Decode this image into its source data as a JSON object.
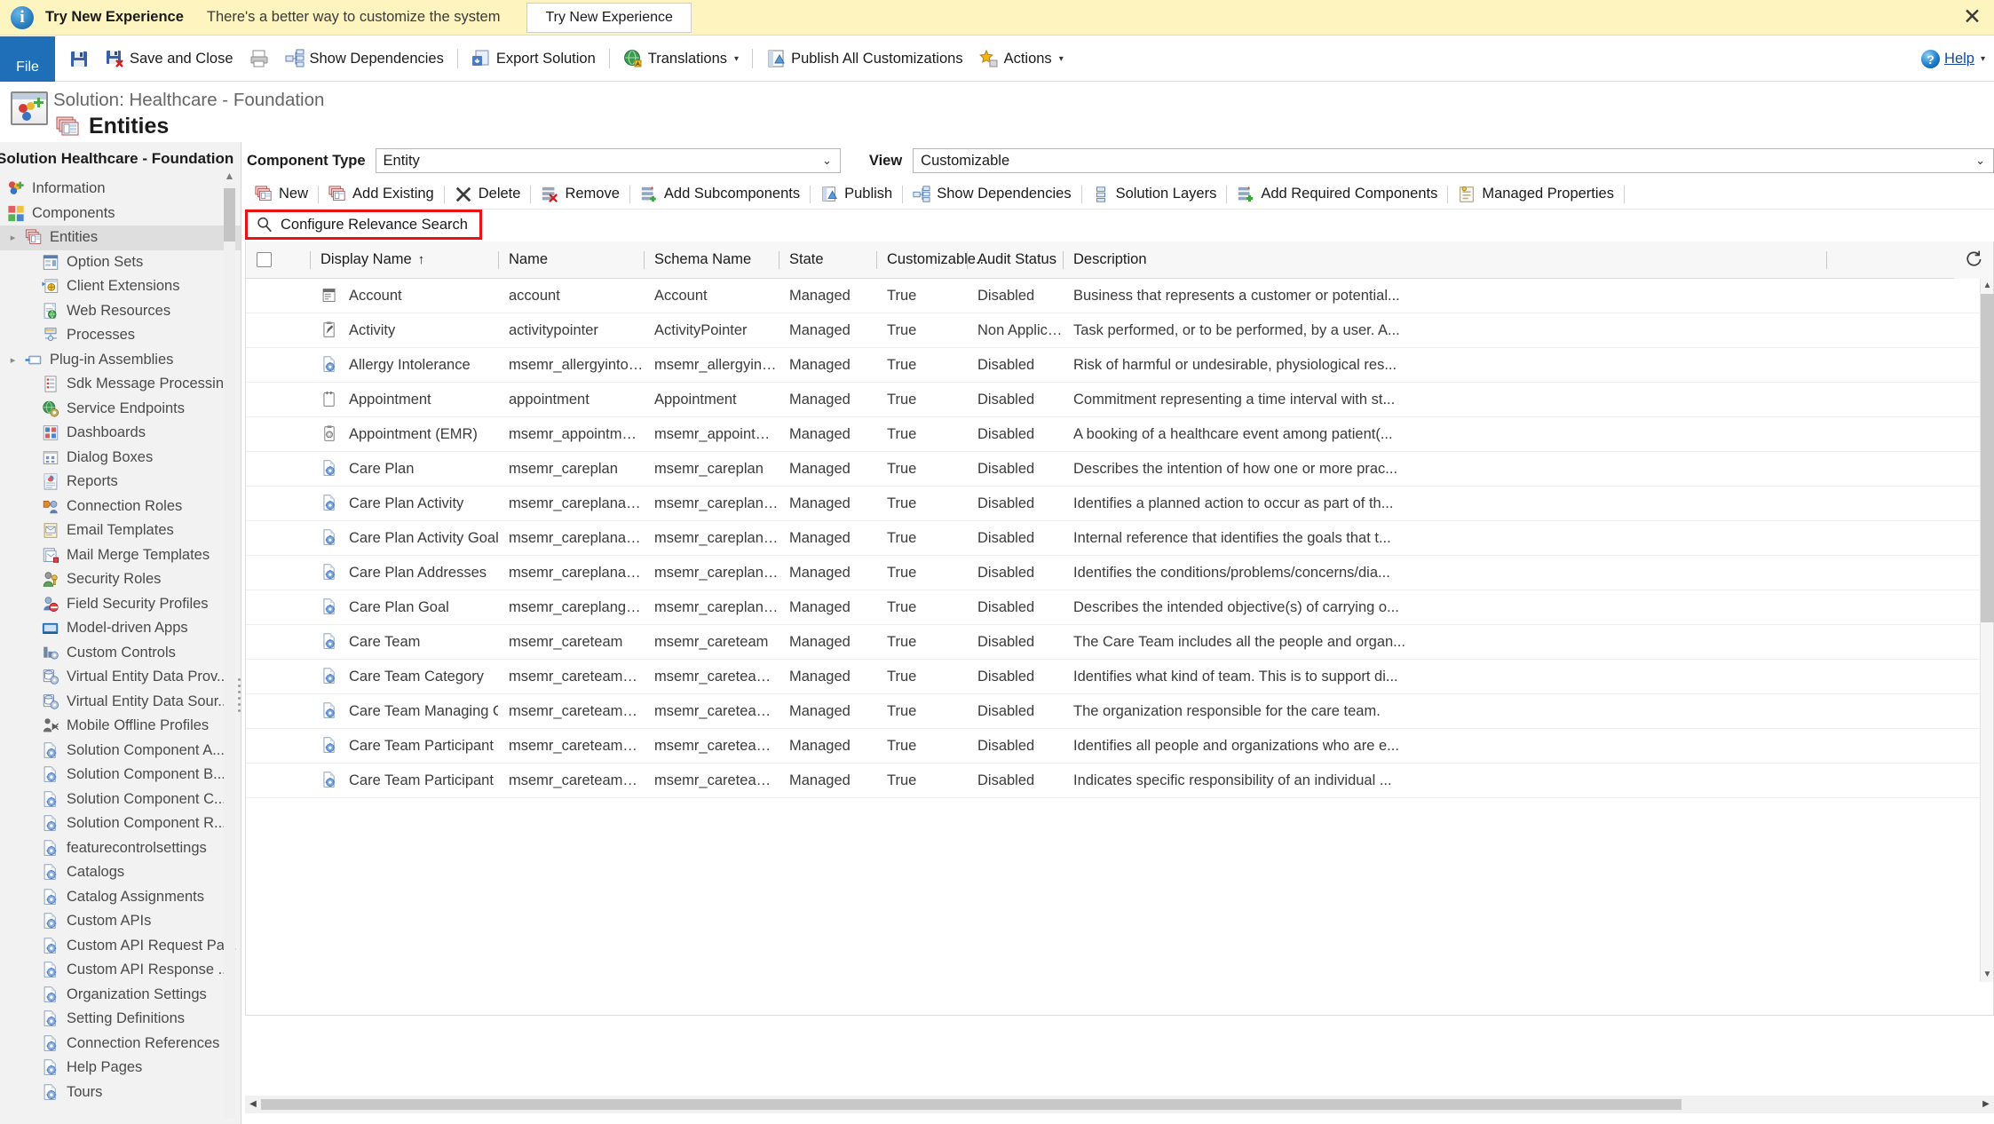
{
  "notification": {
    "title": "Try New Experience",
    "message": "There's a better way to customize the system",
    "button": "Try New Experience",
    "close": "✕",
    "bg_color": "#fdf4bf"
  },
  "command_bar": {
    "file_tab": "File",
    "items": [
      {
        "name": "save",
        "label": "",
        "icon": "save-icon"
      },
      {
        "name": "save-and-close",
        "label": "Save and Close",
        "icon": "save-close-icon"
      },
      {
        "name": "print",
        "label": "",
        "icon": "print-icon"
      },
      {
        "name": "show-dependencies",
        "label": "Show Dependencies",
        "icon": "dependencies-icon"
      },
      {
        "name": "export-solution",
        "label": "Export Solution",
        "icon": "export-icon"
      },
      {
        "name": "translations",
        "label": "Translations",
        "icon": "globe-icon",
        "caret": "▾"
      },
      {
        "name": "publish-all-customizations",
        "label": "Publish All Customizations",
        "icon": "publish-icon"
      },
      {
        "name": "actions",
        "label": "Actions",
        "icon": "star-icon",
        "caret": "▾"
      }
    ],
    "help": "Help",
    "help_caret": "▾"
  },
  "solution_header": {
    "title": "Solution: Healthcare - Foundation",
    "section": "Entities"
  },
  "sidebar": {
    "title": "Solution Healthcare - Foundation",
    "items": [
      {
        "label": "Information",
        "level": 1,
        "icon": "information-icon",
        "arrow": "",
        "selected": false
      },
      {
        "label": "Components",
        "level": 1,
        "icon": "components-icon",
        "arrow": "",
        "selected": false
      },
      {
        "label": "Entities",
        "level": 2,
        "icon": "entities-icon",
        "arrow": "▸",
        "selected": true
      },
      {
        "label": "Option Sets",
        "level": 2,
        "icon": "option-sets-icon",
        "arrow": "",
        "selected": false
      },
      {
        "label": "Client Extensions",
        "level": 2,
        "icon": "client-extensions-icon",
        "arrow": "",
        "selected": false
      },
      {
        "label": "Web Resources",
        "level": 2,
        "icon": "web-resources-icon",
        "arrow": "",
        "selected": false
      },
      {
        "label": "Processes",
        "level": 2,
        "icon": "processes-icon",
        "arrow": "",
        "selected": false
      },
      {
        "label": "Plug-in Assemblies",
        "level": 2,
        "icon": "plugin-assemblies-icon",
        "arrow": "▸",
        "selected": false
      },
      {
        "label": "Sdk Message Processin...",
        "level": 2,
        "icon": "sdk-message-icon",
        "arrow": "",
        "selected": false
      },
      {
        "label": "Service Endpoints",
        "level": 2,
        "icon": "service-endpoints-icon",
        "arrow": "",
        "selected": false
      },
      {
        "label": "Dashboards",
        "level": 2,
        "icon": "dashboards-icon",
        "arrow": "",
        "selected": false
      },
      {
        "label": "Dialog Boxes",
        "level": 2,
        "icon": "dialog-boxes-icon",
        "arrow": "",
        "selected": false
      },
      {
        "label": "Reports",
        "level": 2,
        "icon": "reports-icon",
        "arrow": "",
        "selected": false
      },
      {
        "label": "Connection Roles",
        "level": 2,
        "icon": "connection-roles-icon",
        "arrow": "",
        "selected": false
      },
      {
        "label": "Email Templates",
        "level": 2,
        "icon": "email-templates-icon",
        "arrow": "",
        "selected": false
      },
      {
        "label": "Mail Merge Templates",
        "level": 2,
        "icon": "mail-merge-icon",
        "arrow": "",
        "selected": false
      },
      {
        "label": "Security Roles",
        "level": 2,
        "icon": "security-roles-icon",
        "arrow": "",
        "selected": false
      },
      {
        "label": "Field Security Profiles",
        "level": 2,
        "icon": "field-security-icon",
        "arrow": "",
        "selected": false
      },
      {
        "label": "Model-driven Apps",
        "level": 2,
        "icon": "model-driven-apps-icon",
        "arrow": "",
        "selected": false
      },
      {
        "label": "Custom Controls",
        "level": 2,
        "icon": "custom-controls-icon",
        "arrow": "",
        "selected": false
      },
      {
        "label": "Virtual Entity Data Prov...",
        "level": 2,
        "icon": "virtual-entity-provider-icon",
        "arrow": "",
        "selected": false
      },
      {
        "label": "Virtual Entity Data Sour...",
        "level": 2,
        "icon": "virtual-entity-source-icon",
        "arrow": "",
        "selected": false
      },
      {
        "label": "Mobile Offline Profiles",
        "level": 2,
        "icon": "mobile-offline-icon",
        "arrow": "",
        "selected": false
      },
      {
        "label": "Solution Component A...",
        "level": 2,
        "icon": "solution-component-icon",
        "arrow": "",
        "selected": false
      },
      {
        "label": "Solution Component B...",
        "level": 2,
        "icon": "solution-component-icon",
        "arrow": "",
        "selected": false
      },
      {
        "label": "Solution Component C...",
        "level": 2,
        "icon": "solution-component-icon",
        "arrow": "",
        "selected": false
      },
      {
        "label": "Solution Component R...",
        "level": 2,
        "icon": "solution-component-icon",
        "arrow": "",
        "selected": false
      },
      {
        "label": "featurecontrolsettings",
        "level": 2,
        "icon": "solution-component-icon",
        "arrow": "",
        "selected": false
      },
      {
        "label": "Catalogs",
        "level": 2,
        "icon": "solution-component-icon",
        "arrow": "",
        "selected": false
      },
      {
        "label": "Catalog Assignments",
        "level": 2,
        "icon": "solution-component-icon",
        "arrow": "",
        "selected": false
      },
      {
        "label": "Custom APIs",
        "level": 2,
        "icon": "solution-component-icon",
        "arrow": "",
        "selected": false
      },
      {
        "label": "Custom API Request Pa...",
        "level": 2,
        "icon": "solution-component-icon",
        "arrow": "",
        "selected": false
      },
      {
        "label": "Custom API Response ...",
        "level": 2,
        "icon": "solution-component-icon",
        "arrow": "",
        "selected": false
      },
      {
        "label": "Organization Settings",
        "level": 2,
        "icon": "solution-component-icon",
        "arrow": "",
        "selected": false
      },
      {
        "label": "Setting Definitions",
        "level": 2,
        "icon": "solution-component-icon",
        "arrow": "",
        "selected": false
      },
      {
        "label": "Connection References",
        "level": 2,
        "icon": "solution-component-icon",
        "arrow": "",
        "selected": false
      },
      {
        "label": "Help Pages",
        "level": 2,
        "icon": "solution-component-icon",
        "arrow": "",
        "selected": false
      },
      {
        "label": "Tours",
        "level": 2,
        "icon": "solution-component-icon",
        "arrow": "",
        "selected": false
      }
    ]
  },
  "filters": {
    "component_type_label": "Component Type",
    "component_type_value": "Entity",
    "view_label": "View",
    "view_value": "Customizable",
    "chevron": "⌄"
  },
  "grid_toolbar": [
    {
      "name": "new",
      "label": "New",
      "icon": "new-entity-icon"
    },
    {
      "name": "add-existing",
      "label": "Add Existing",
      "icon": "add-existing-icon"
    },
    {
      "name": "delete",
      "label": "Delete",
      "icon": "delete-x-icon"
    },
    {
      "name": "remove",
      "label": "Remove",
      "icon": "remove-icon"
    },
    {
      "name": "add-subcomponents",
      "label": "Add Subcomponents",
      "icon": "add-subcomponents-icon"
    },
    {
      "name": "publish",
      "label": "Publish",
      "icon": "publish-grid-icon"
    },
    {
      "name": "show-dependencies",
      "label": "Show Dependencies",
      "icon": "dependencies-grid-icon"
    },
    {
      "name": "solution-layers",
      "label": "Solution Layers",
      "icon": "layers-icon"
    },
    {
      "name": "add-required-components",
      "label": "Add Required Components",
      "icon": "add-required-icon"
    },
    {
      "name": "managed-properties",
      "label": "Managed Properties",
      "icon": "managed-properties-icon"
    }
  ],
  "relevance_search": {
    "label": "Configure Relevance Search",
    "icon": "search-icon",
    "highlight_color": "#e81313"
  },
  "grid": {
    "columns": [
      {
        "key": "check",
        "label": ""
      },
      {
        "key": "display_name",
        "label": "Display Name",
        "sort": "↑"
      },
      {
        "key": "name",
        "label": "Name",
        "sort": ""
      },
      {
        "key": "schema_name",
        "label": "Schema Name",
        "sort": ""
      },
      {
        "key": "state",
        "label": "State",
        "sort": ""
      },
      {
        "key": "customizable",
        "label": "Customizable...",
        "sort": ""
      },
      {
        "key": "audit_status",
        "label": "Audit Status",
        "sort": ""
      },
      {
        "key": "description",
        "label": "Description",
        "sort": ""
      }
    ],
    "refresh_icon": "refresh-icon",
    "rows": [
      {
        "icon": "account-entity-icon",
        "display_name": "Account",
        "name": "account",
        "schema_name": "Account",
        "state": "Managed",
        "customizable": "True",
        "audit_status": "Disabled",
        "description": "Business that represents a customer or potential..."
      },
      {
        "icon": "activity-entity-icon",
        "display_name": "Activity",
        "name": "activitypointer",
        "schema_name": "ActivityPointer",
        "state": "Managed",
        "customizable": "True",
        "audit_status": "Non Applicable",
        "description": "Task performed, or to be performed, by a user. A..."
      },
      {
        "icon": "custom-entity-icon",
        "display_name": "Allergy Intolerance",
        "name": "msemr_allergyintolera...",
        "schema_name": "msemr_allergyintolera...",
        "state": "Managed",
        "customizable": "True",
        "audit_status": "Disabled",
        "description": "Risk of harmful or undesirable, physiological res..."
      },
      {
        "icon": "appointment-entity-icon",
        "display_name": "Appointment",
        "name": "appointment",
        "schema_name": "Appointment",
        "state": "Managed",
        "customizable": "True",
        "audit_status": "Disabled",
        "description": "Commitment representing a time interval with st..."
      },
      {
        "icon": "appointment-emr-entity-icon",
        "display_name": "Appointment (EMR)",
        "name": "msemr_appointmente...",
        "schema_name": "msemr_appointmente...",
        "state": "Managed",
        "customizable": "True",
        "audit_status": "Disabled",
        "description": "A booking of a healthcare event among patient(..."
      },
      {
        "icon": "custom-entity-icon",
        "display_name": "Care Plan",
        "name": "msemr_careplan",
        "schema_name": "msemr_careplan",
        "state": "Managed",
        "customizable": "True",
        "audit_status": "Disabled",
        "description": "Describes the intention of how one or more prac..."
      },
      {
        "icon": "custom-entity-icon",
        "display_name": "Care Plan Activity",
        "name": "msemr_careplanactivity",
        "schema_name": "msemr_careplanactivity",
        "state": "Managed",
        "customizable": "True",
        "audit_status": "Disabled",
        "description": "Identifies a planned action to occur as part of th..."
      },
      {
        "icon": "custom-entity-icon",
        "display_name": "Care Plan Activity Goal",
        "name": "msemr_careplanactivit...",
        "schema_name": "msemr_careplanactivit...",
        "state": "Managed",
        "customizable": "True",
        "audit_status": "Disabled",
        "description": "Internal reference that identifies the goals that t..."
      },
      {
        "icon": "custom-entity-icon",
        "display_name": "Care Plan Addresses",
        "name": "msemr_careplanaddre...",
        "schema_name": "msemr_careplanaddre...",
        "state": "Managed",
        "customizable": "True",
        "audit_status": "Disabled",
        "description": "Identifies the conditions/problems/concerns/dia..."
      },
      {
        "icon": "custom-entity-icon",
        "display_name": "Care Plan Goal",
        "name": "msemr_careplangoal",
        "schema_name": "msemr_careplangoal",
        "state": "Managed",
        "customizable": "True",
        "audit_status": "Disabled",
        "description": "Describes the intended objective(s) of carrying o..."
      },
      {
        "icon": "custom-entity-icon",
        "display_name": "Care Team",
        "name": "msemr_careteam",
        "schema_name": "msemr_careteam",
        "state": "Managed",
        "customizable": "True",
        "audit_status": "Disabled",
        "description": "The Care Team includes all the people and organ..."
      },
      {
        "icon": "custom-entity-icon",
        "display_name": "Care Team Category",
        "name": "msemr_careteamcateg...",
        "schema_name": "msemr_careteamcateg...",
        "state": "Managed",
        "customizable": "True",
        "audit_status": "Disabled",
        "description": "Identifies what kind of team. This is to support di..."
      },
      {
        "icon": "custom-entity-icon",
        "display_name": "Care Team Managing Organiza...",
        "name": "msemr_careteammana...",
        "schema_name": "msemr_careteammana...",
        "state": "Managed",
        "customizable": "True",
        "audit_status": "Disabled",
        "description": "The organization responsible for the care team."
      },
      {
        "icon": "custom-entity-icon",
        "display_name": "Care Team Participant",
        "name": "msemr_careteamparti...",
        "schema_name": "msemr_careteamparti...",
        "state": "Managed",
        "customizable": "True",
        "audit_status": "Disabled",
        "description": "Identifies all people and organizations who are e..."
      },
      {
        "icon": "custom-entity-icon",
        "display_name": "Care Team Participant Role",
        "name": "msemr_careteamparti...",
        "schema_name": "msemr_careteamparti...",
        "state": "Managed",
        "customizable": "True",
        "audit_status": "Disabled",
        "description": "Indicates specific responsibility of an individual ..."
      }
    ]
  },
  "scrollbars": {
    "up_arrow": "▲",
    "down_arrow": "▼",
    "left_arrow": "◀",
    "right_arrow": "▶"
  }
}
